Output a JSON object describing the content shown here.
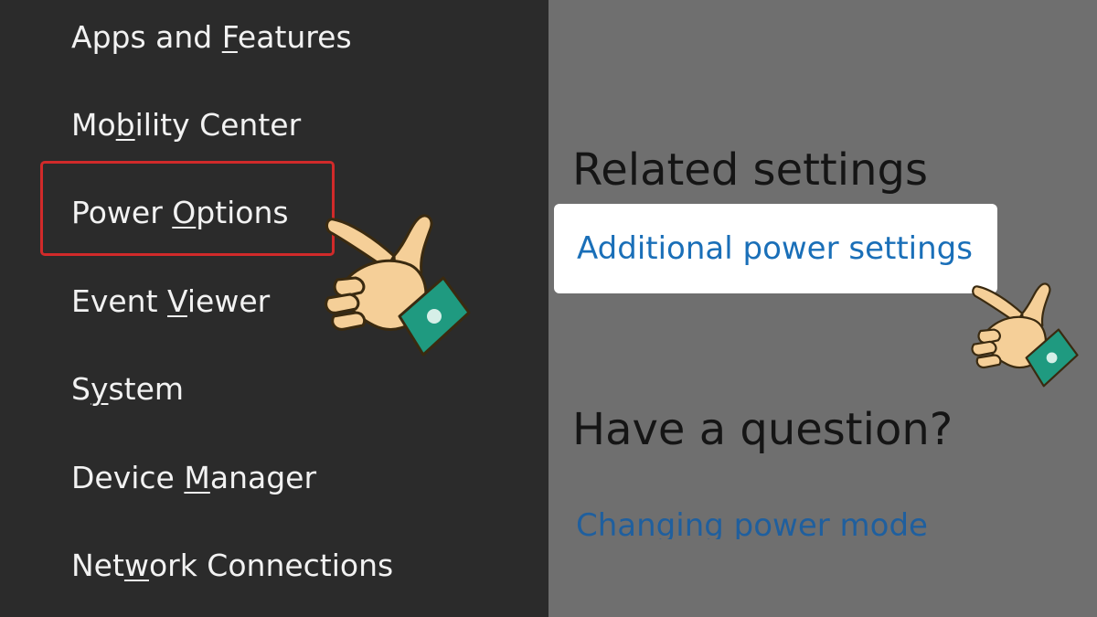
{
  "menu": {
    "items": [
      {
        "before": "Apps and ",
        "under": "F",
        "after": "eatures"
      },
      {
        "before": "Mo",
        "under": "b",
        "after": "ility Center"
      },
      {
        "before": "Power ",
        "under": "O",
        "after": "ptions"
      },
      {
        "before": "Event ",
        "under": "V",
        "after": "iewer"
      },
      {
        "before": "S",
        "under": "y",
        "after": "stem"
      },
      {
        "before": "Device ",
        "under": "M",
        "after": "anager"
      },
      {
        "before": "Net",
        "under": "w",
        "after": "ork Connections"
      }
    ]
  },
  "settings": {
    "related_heading": "Related settings",
    "additional_link": "Additional power settings",
    "question_heading": "Have a question?",
    "changing_link": "Changing power mode"
  },
  "colors": {
    "menu_bg": "#2b2b2b",
    "settings_bg": "#6f6f6f",
    "highlight": "#d12a2a",
    "link": "#1a6fb8"
  },
  "icons": [
    "pointing-hand-icon"
  ]
}
